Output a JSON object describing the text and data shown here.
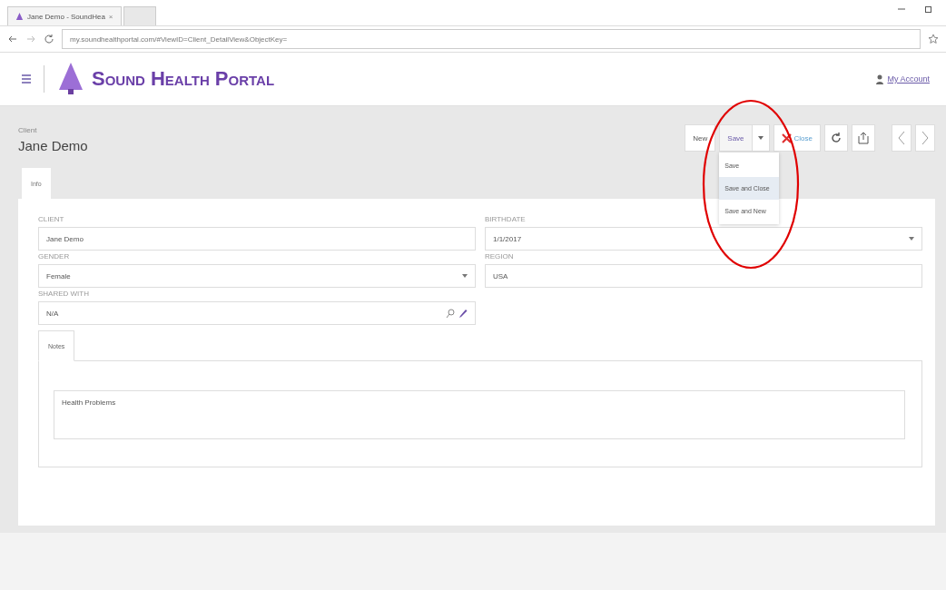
{
  "browser": {
    "tabs": [
      {
        "title": "Jane Demo - SoundHea",
        "close": "×",
        "selected": true
      },
      {
        "selected": false
      }
    ],
    "url": "my.soundhealthportal.com/#ViewID=Client_DetailView&ObjectKey="
  },
  "header": {
    "brand": "Sound Health Portal",
    "account": "My Account"
  },
  "record": {
    "caption": "Client",
    "name": "Jane Demo"
  },
  "toolbar": {
    "new": "New",
    "save": "Save",
    "close": "Close",
    "menu": [
      {
        "label": "Save",
        "selected": false
      },
      {
        "label": "Save and Close",
        "selected": true
      },
      {
        "label": "Save and New",
        "selected": false
      }
    ]
  },
  "tabs": [
    {
      "label": "Info",
      "selected": true
    }
  ],
  "fields": [
    {
      "label": "CLIENT",
      "value": "Jane Demo",
      "kind": "text"
    },
    {
      "label": "BIRTHDATE",
      "value": "1/1/2017",
      "kind": "select"
    },
    {
      "label": "GENDER",
      "value": "Female",
      "kind": "select"
    },
    {
      "label": "REGION",
      "value": "USA",
      "kind": "text"
    },
    {
      "label": "SHARED WITH",
      "value": "N/A",
      "kind": "lookup"
    }
  ],
  "notes": {
    "tabs": [
      {
        "label": "Notes",
        "selected": true
      }
    ],
    "text": "Health Problems"
  },
  "annotation": {
    "kind": "ellipse",
    "color": "#e00000"
  }
}
